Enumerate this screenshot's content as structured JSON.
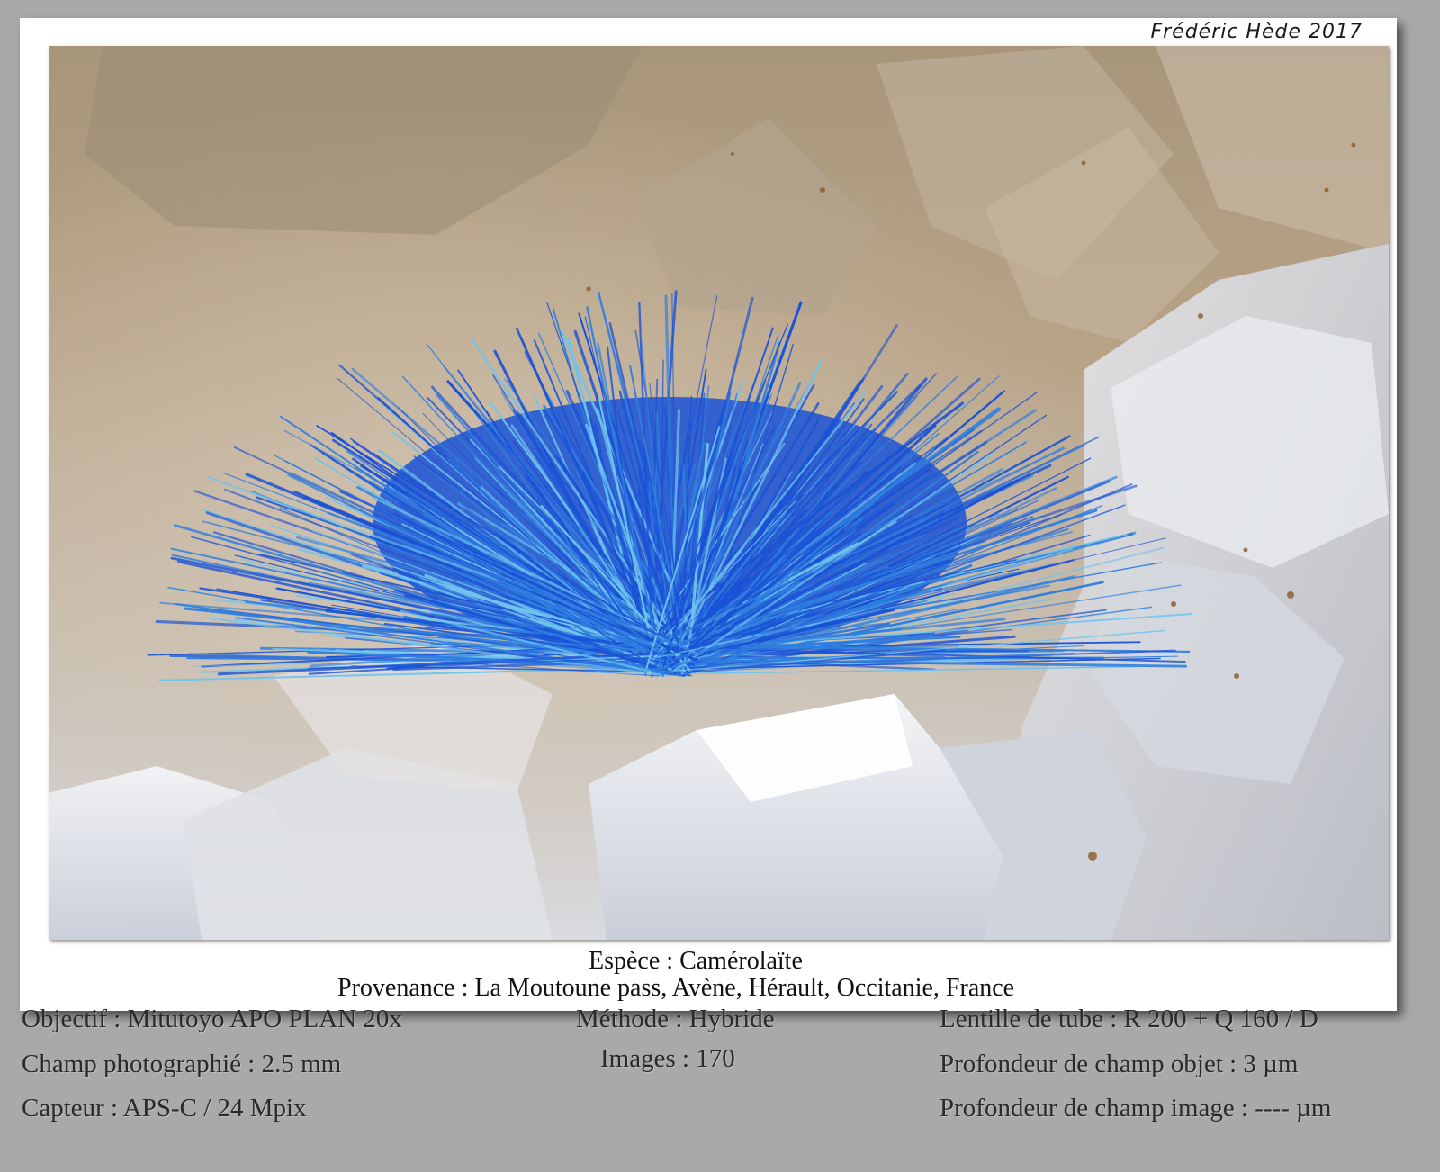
{
  "signature": "Frédéric Hède 2017",
  "photo": {
    "subject": "blue radiating acicular crystal spray on quartz crystals",
    "accent_colors": {
      "spray_core": "#1a52d6",
      "spray_light": "#6fc4ef",
      "matrix_beige": "#b9a78c",
      "quartz_white": "#e8ecf2"
    }
  },
  "caption": {
    "species": "Espèce : Camérolaïte",
    "origin": "Provenance : La Moutoune pass, Avène, Hérault, Occitanie, France"
  },
  "meta": {
    "objective": "Objectif : Mitutoyo APO PLAN 20x",
    "field": "Champ photographié : 2.5 mm",
    "sensor": "Capteur : APS-C / 24 Mpix",
    "method": "Méthode : Hybride",
    "images": "Images : 170",
    "tube_lens": "Lentille de tube : R 200 + Q 160 / D",
    "dof_object": "Profondeur de champ objet : 3 µm",
    "dof_image": "Profondeur de champ image : ---- µm"
  }
}
